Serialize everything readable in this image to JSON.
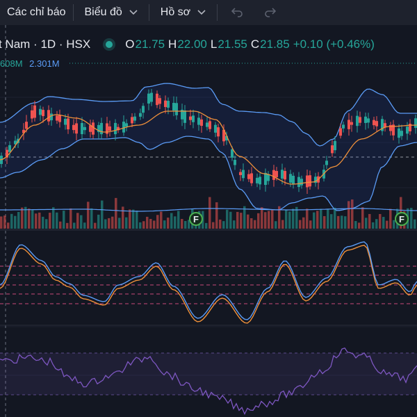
{
  "toolbar": {
    "indicators_label": "Các chỉ báo",
    "chart_label": "Biểu đồ",
    "profile_label": "Hồ sơ"
  },
  "symbol": {
    "name": "t Nam · 1D · HSX",
    "ohlc": [
      {
        "key": "O",
        "value": "21.75"
      },
      {
        "key": "H",
        "value": "22.00"
      },
      {
        "key": "L",
        "value": "21.55"
      },
      {
        "key": "C",
        "value": "21.85"
      }
    ],
    "change": "+0.10 (+0.46%)"
  },
  "volume": {
    "value_1": "608M",
    "value_2": "2.301M"
  },
  "markers": [
    {
      "label": "F"
    },
    {
      "label": "F"
    }
  ],
  "colors": {
    "background": "#131722",
    "up": "#26a69a",
    "down": "#ef5350",
    "bollinger": "#5b9cf6",
    "ma": "#f0913a",
    "rsi": "#7e57c2"
  },
  "icons": [
    "chevron-down-icon",
    "undo-icon",
    "redo-icon"
  ]
}
